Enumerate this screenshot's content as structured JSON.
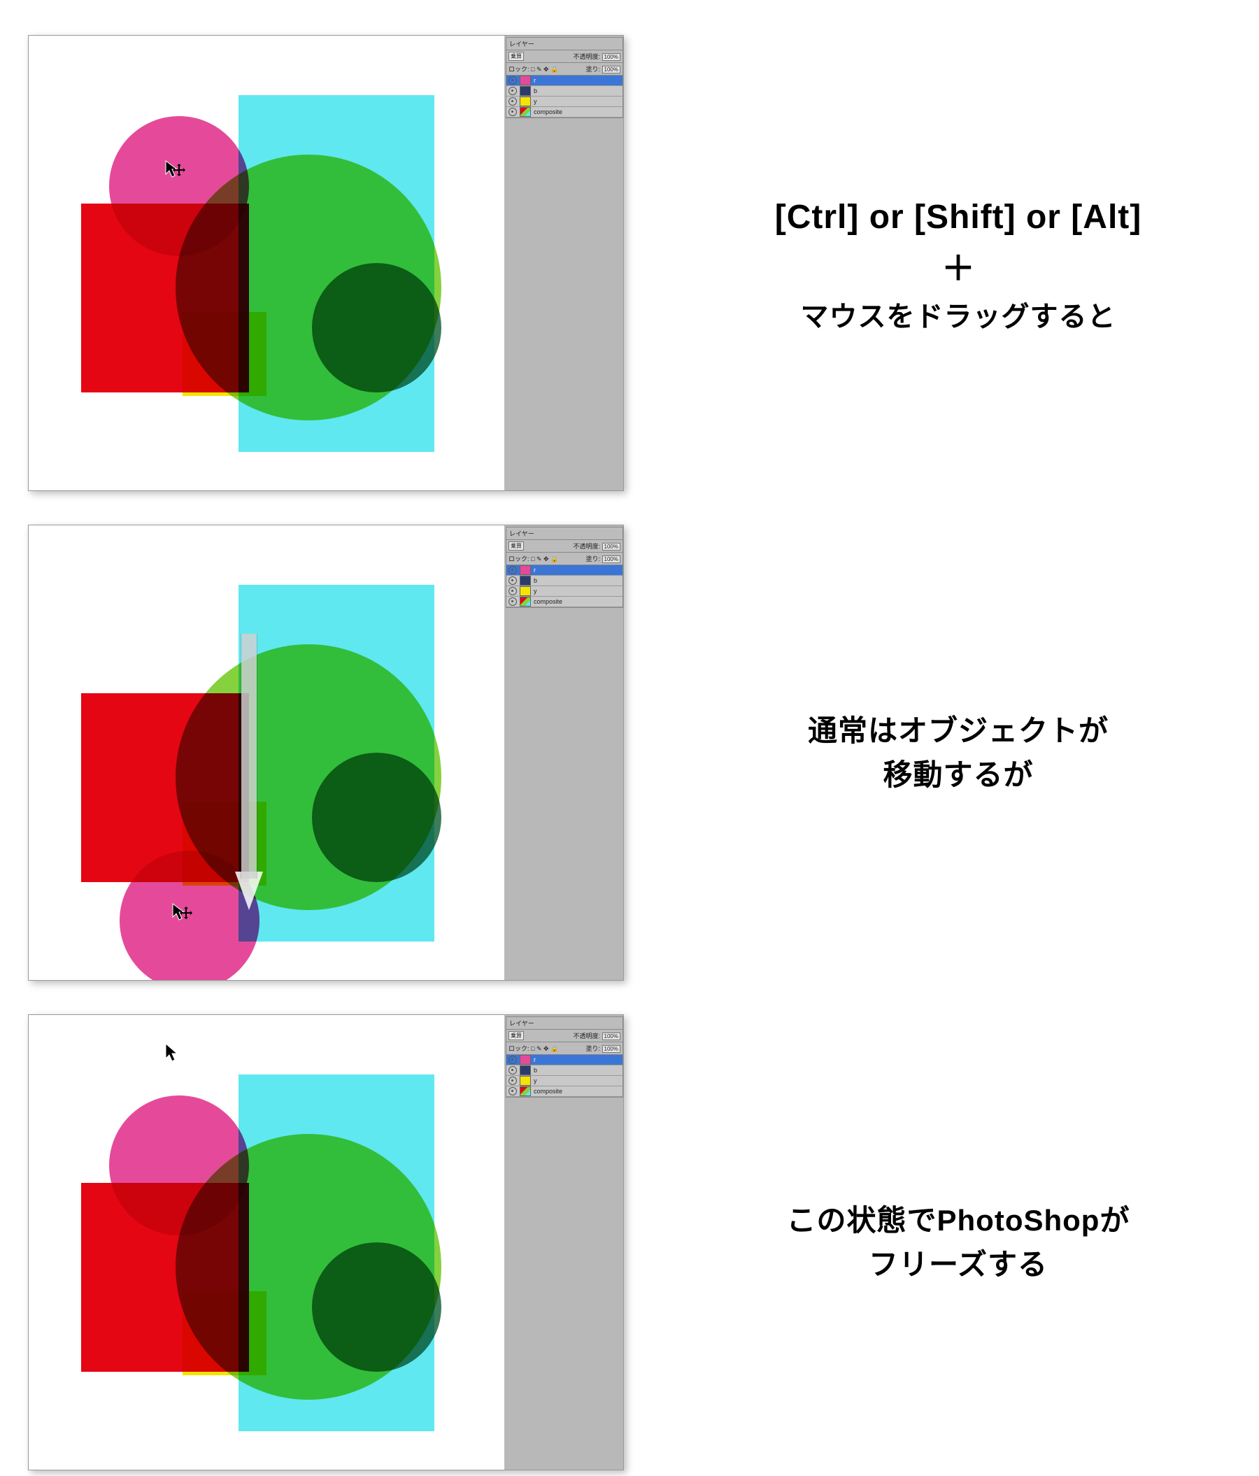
{
  "captions": {
    "c1_line1": "[Ctrl] or [Shift] or [Alt]",
    "c1_plus": "＋",
    "c1_line2": "マウスをドラッグすると",
    "c2_line1": "通常はオブジェクトが",
    "c2_line2": "移動するが",
    "c3_line1": "この状態でPhotoShopが",
    "c3_line2": "フリーズする"
  },
  "panel": {
    "tab": "レイヤー",
    "mode": "乗算",
    "opacity_label": "不透明度:",
    "opacity_val": "100%",
    "lock_label": "ロック:",
    "fill_label": "塗り:",
    "fill_val": "100%",
    "layers": [
      {
        "name": "r"
      },
      {
        "name": "b"
      },
      {
        "name": "y"
      },
      {
        "name": "composite"
      }
    ]
  }
}
